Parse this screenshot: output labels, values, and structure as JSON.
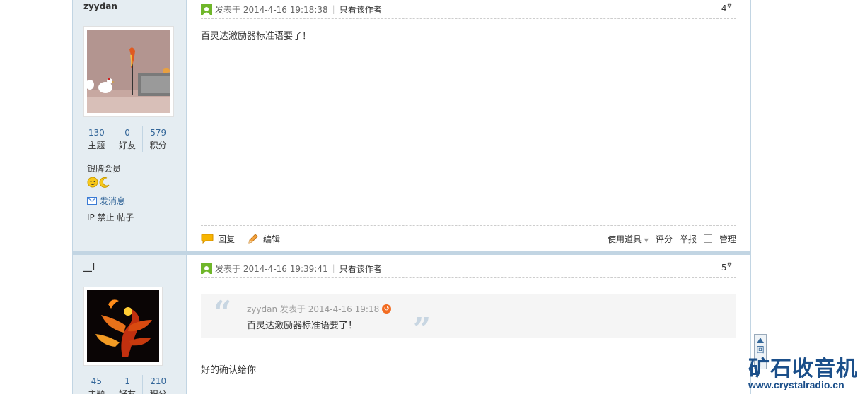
{
  "posts": [
    {
      "author": "zyydan",
      "stats": [
        {
          "num": "130",
          "label": "主题"
        },
        {
          "num": "0",
          "label": "好友"
        },
        {
          "num": "579",
          "label": "积分"
        }
      ],
      "rank": "银牌会员",
      "send_msg": "发消息",
      "ip_line": "IP 禁止 帖子",
      "posted": "发表于 2014-4-16 19:18:38",
      "only_author": "只看该作者",
      "floor": "4",
      "floor_mark": "#",
      "message": "百灵达激励器标准语要了！",
      "actions": {
        "reply": "回复",
        "edit": "编辑",
        "tools": "使用道具",
        "rate": "评分",
        "report": "举报",
        "manage": "管理"
      }
    },
    {
      "author": "__l",
      "stats": [
        {
          "num": "45",
          "label": "主题"
        },
        {
          "num": "1",
          "label": "好友"
        },
        {
          "num": "210",
          "label": "积分"
        }
      ],
      "posted": "发表于 2014-4-16 19:39:41",
      "only_author": "只看该作者",
      "floor": "5",
      "floor_mark": "#",
      "quote": {
        "author": "zyydan 发表于 2014-4-16 19:18",
        "text": "百灵达激励器标准语要了！"
      },
      "message": "好的确认给你"
    }
  ],
  "back_to_top": "回",
  "watermark": {
    "title": "矿石收音机",
    "url": "www.crystalradio.cn"
  }
}
